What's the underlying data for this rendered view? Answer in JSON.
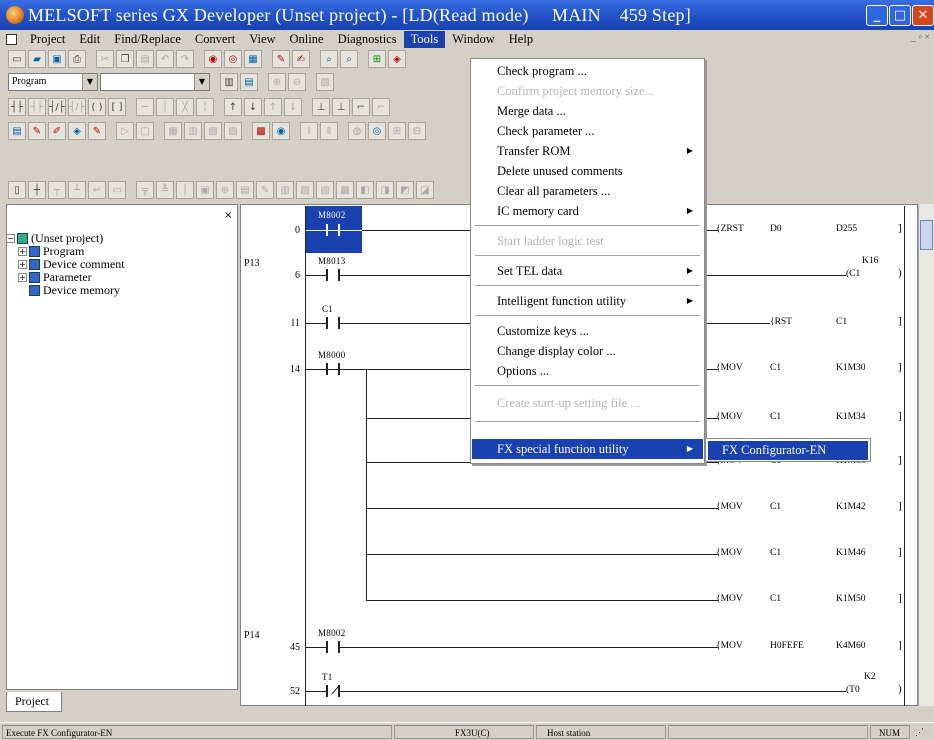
{
  "window": {
    "title": "MELSOFT series GX Developer (Unset project) - [LD(Read mode)     MAIN    459 Step]"
  },
  "menubar": {
    "items": [
      "Project",
      "Edit",
      "Find/Replace",
      "Convert",
      "View",
      "Online",
      "Diagnostics",
      "Tools",
      "Window",
      "Help"
    ],
    "active": "Tools"
  },
  "toolbar": {
    "mode_combo": "Program",
    "program_combo": ""
  },
  "project_tree": {
    "root": "(Unset project)",
    "children": [
      "Program",
      "Device comment",
      "Parameter",
      "Device memory"
    ],
    "tab_label": "Project"
  },
  "tools_menu": {
    "items": [
      {
        "label": "Check program ...",
        "enabled": true
      },
      {
        "label": "Confirm project memory size...",
        "enabled": false
      },
      {
        "label": "Merge data ...",
        "enabled": true
      },
      {
        "label": "Check parameter ...",
        "enabled": true
      },
      {
        "label": "Transfer ROM",
        "enabled": true,
        "submenu": true
      },
      {
        "label": "Delete unused comments",
        "enabled": true
      },
      {
        "label": "Clear all parameters ...",
        "enabled": true
      },
      {
        "label": "IC memory card",
        "enabled": true,
        "submenu": true
      },
      {
        "label": "Start ladder logic test",
        "enabled": false
      },
      {
        "label": "Set TEL data",
        "enabled": true,
        "submenu": true
      },
      {
        "label": "Intelligent function utility",
        "enabled": true,
        "submenu": true
      },
      {
        "label": "Customize keys ...",
        "enabled": true
      },
      {
        "label": "Change display color ...",
        "enabled": true
      },
      {
        "label": "Options ...",
        "enabled": true
      },
      {
        "label": "Create start-up setting file ...",
        "enabled": false
      },
      {
        "label": "FX special function utility",
        "enabled": true,
        "submenu": true,
        "highlighted": true
      }
    ],
    "submenu_item": "FX Configurator-EN"
  },
  "ladder": {
    "rungs": [
      {
        "step": "0",
        "pointer": "",
        "contact": "M8002",
        "instr": "ZRST",
        "op1": "D0",
        "op2": "D255"
      },
      {
        "step": "6",
        "pointer": "P13",
        "contact": "M8013",
        "instr": "C1",
        "op1": "K16",
        "op2": ""
      },
      {
        "step": "11",
        "pointer": "",
        "contact": "C1",
        "instr": "RST",
        "op1": "C1",
        "op2": ""
      },
      {
        "step": "14",
        "pointer": "",
        "contact": "M8000",
        "instr": "MOV",
        "op1": "C1",
        "op2": "K1M30"
      },
      {
        "step": "",
        "pointer": "",
        "contact": "",
        "instr": "MOV",
        "op1": "C1",
        "op2": "K1M34"
      },
      {
        "step": "",
        "pointer": "",
        "contact": "",
        "instr": "MOV",
        "op1": "C1",
        "op2": "K1M38"
      },
      {
        "step": "",
        "pointer": "",
        "contact": "",
        "instr": "MOV",
        "op1": "C1",
        "op2": "K1M42"
      },
      {
        "step": "",
        "pointer": "",
        "contact": "",
        "instr": "MOV",
        "op1": "C1",
        "op2": "K1M46"
      },
      {
        "step": "",
        "pointer": "",
        "contact": "",
        "instr": "MOV",
        "op1": "C1",
        "op2": "K1M50"
      },
      {
        "step": "45",
        "pointer": "P14",
        "contact": "M8002",
        "instr": "MOV",
        "op1": "H0FEFE",
        "op2": "K4M60"
      },
      {
        "step": "52",
        "pointer": "",
        "contact": "T1",
        "instr": "T0",
        "op1": "K2",
        "op2": ""
      }
    ]
  },
  "statusbar": {
    "message": "Execute FX Configurator-EN",
    "plc": "FX3U(C)",
    "station": "Host station",
    "mode": "NUM"
  }
}
